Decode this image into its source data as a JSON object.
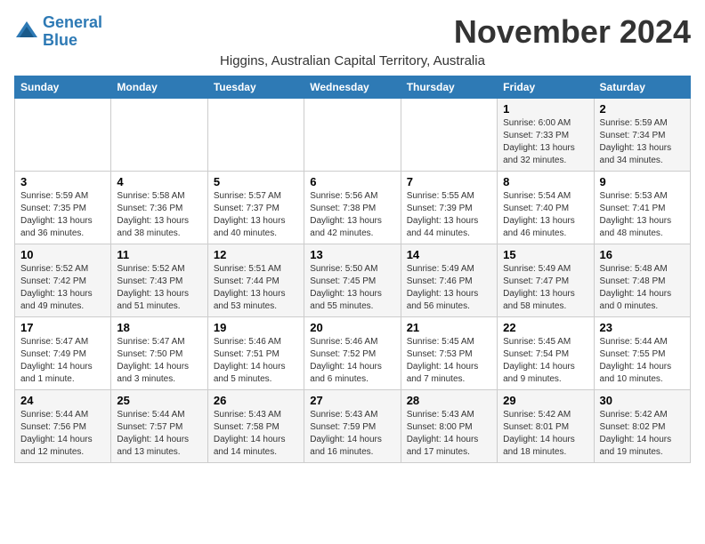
{
  "logo": {
    "line1": "General",
    "line2": "Blue"
  },
  "title": "November 2024",
  "subtitle": "Higgins, Australian Capital Territory, Australia",
  "header": {
    "days": [
      "Sunday",
      "Monday",
      "Tuesday",
      "Wednesday",
      "Thursday",
      "Friday",
      "Saturday"
    ]
  },
  "weeks": [
    [
      {
        "day": "",
        "info": ""
      },
      {
        "day": "",
        "info": ""
      },
      {
        "day": "",
        "info": ""
      },
      {
        "day": "",
        "info": ""
      },
      {
        "day": "",
        "info": ""
      },
      {
        "day": "1",
        "info": "Sunrise: 6:00 AM\nSunset: 7:33 PM\nDaylight: 13 hours and 32 minutes."
      },
      {
        "day": "2",
        "info": "Sunrise: 5:59 AM\nSunset: 7:34 PM\nDaylight: 13 hours and 34 minutes."
      }
    ],
    [
      {
        "day": "3",
        "info": "Sunrise: 5:59 AM\nSunset: 7:35 PM\nDaylight: 13 hours and 36 minutes."
      },
      {
        "day": "4",
        "info": "Sunrise: 5:58 AM\nSunset: 7:36 PM\nDaylight: 13 hours and 38 minutes."
      },
      {
        "day": "5",
        "info": "Sunrise: 5:57 AM\nSunset: 7:37 PM\nDaylight: 13 hours and 40 minutes."
      },
      {
        "day": "6",
        "info": "Sunrise: 5:56 AM\nSunset: 7:38 PM\nDaylight: 13 hours and 42 minutes."
      },
      {
        "day": "7",
        "info": "Sunrise: 5:55 AM\nSunset: 7:39 PM\nDaylight: 13 hours and 44 minutes."
      },
      {
        "day": "8",
        "info": "Sunrise: 5:54 AM\nSunset: 7:40 PM\nDaylight: 13 hours and 46 minutes."
      },
      {
        "day": "9",
        "info": "Sunrise: 5:53 AM\nSunset: 7:41 PM\nDaylight: 13 hours and 48 minutes."
      }
    ],
    [
      {
        "day": "10",
        "info": "Sunrise: 5:52 AM\nSunset: 7:42 PM\nDaylight: 13 hours and 49 minutes."
      },
      {
        "day": "11",
        "info": "Sunrise: 5:52 AM\nSunset: 7:43 PM\nDaylight: 13 hours and 51 minutes."
      },
      {
        "day": "12",
        "info": "Sunrise: 5:51 AM\nSunset: 7:44 PM\nDaylight: 13 hours and 53 minutes."
      },
      {
        "day": "13",
        "info": "Sunrise: 5:50 AM\nSunset: 7:45 PM\nDaylight: 13 hours and 55 minutes."
      },
      {
        "day": "14",
        "info": "Sunrise: 5:49 AM\nSunset: 7:46 PM\nDaylight: 13 hours and 56 minutes."
      },
      {
        "day": "15",
        "info": "Sunrise: 5:49 AM\nSunset: 7:47 PM\nDaylight: 13 hours and 58 minutes."
      },
      {
        "day": "16",
        "info": "Sunrise: 5:48 AM\nSunset: 7:48 PM\nDaylight: 14 hours and 0 minutes."
      }
    ],
    [
      {
        "day": "17",
        "info": "Sunrise: 5:47 AM\nSunset: 7:49 PM\nDaylight: 14 hours and 1 minute."
      },
      {
        "day": "18",
        "info": "Sunrise: 5:47 AM\nSunset: 7:50 PM\nDaylight: 14 hours and 3 minutes."
      },
      {
        "day": "19",
        "info": "Sunrise: 5:46 AM\nSunset: 7:51 PM\nDaylight: 14 hours and 5 minutes."
      },
      {
        "day": "20",
        "info": "Sunrise: 5:46 AM\nSunset: 7:52 PM\nDaylight: 14 hours and 6 minutes."
      },
      {
        "day": "21",
        "info": "Sunrise: 5:45 AM\nSunset: 7:53 PM\nDaylight: 14 hours and 7 minutes."
      },
      {
        "day": "22",
        "info": "Sunrise: 5:45 AM\nSunset: 7:54 PM\nDaylight: 14 hours and 9 minutes."
      },
      {
        "day": "23",
        "info": "Sunrise: 5:44 AM\nSunset: 7:55 PM\nDaylight: 14 hours and 10 minutes."
      }
    ],
    [
      {
        "day": "24",
        "info": "Sunrise: 5:44 AM\nSunset: 7:56 PM\nDaylight: 14 hours and 12 minutes."
      },
      {
        "day": "25",
        "info": "Sunrise: 5:44 AM\nSunset: 7:57 PM\nDaylight: 14 hours and 13 minutes."
      },
      {
        "day": "26",
        "info": "Sunrise: 5:43 AM\nSunset: 7:58 PM\nDaylight: 14 hours and 14 minutes."
      },
      {
        "day": "27",
        "info": "Sunrise: 5:43 AM\nSunset: 7:59 PM\nDaylight: 14 hours and 16 minutes."
      },
      {
        "day": "28",
        "info": "Sunrise: 5:43 AM\nSunset: 8:00 PM\nDaylight: 14 hours and 17 minutes."
      },
      {
        "day": "29",
        "info": "Sunrise: 5:42 AM\nSunset: 8:01 PM\nDaylight: 14 hours and 18 minutes."
      },
      {
        "day": "30",
        "info": "Sunrise: 5:42 AM\nSunset: 8:02 PM\nDaylight: 14 hours and 19 minutes."
      }
    ]
  ]
}
